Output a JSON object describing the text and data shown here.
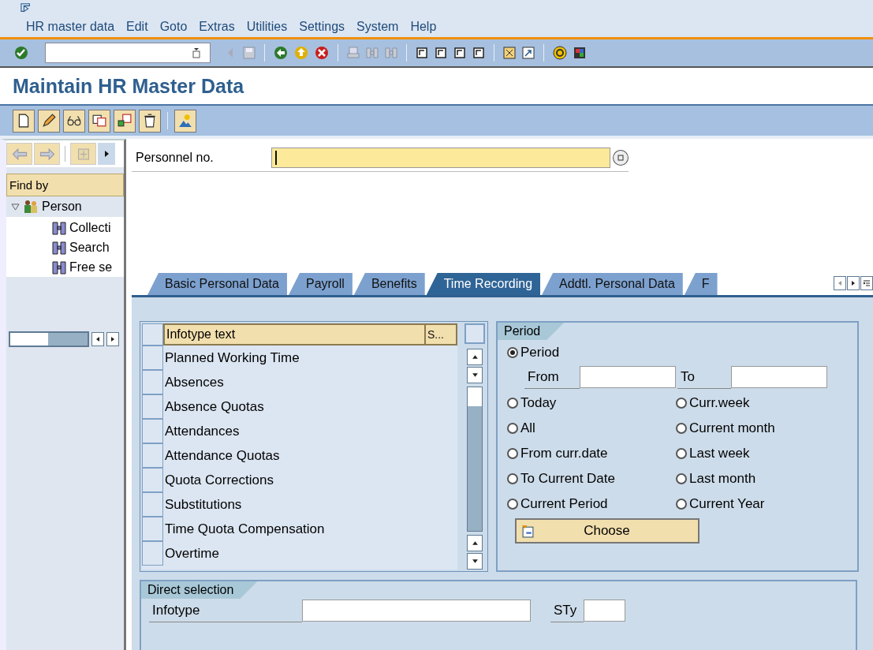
{
  "menu": [
    "HR master data",
    "Edit",
    "Goto",
    "Extras",
    "Utilities",
    "Settings",
    "System",
    "Help"
  ],
  "title": "Maintain HR Master Data",
  "sidebar": {
    "header": "Find by",
    "tree": [
      {
        "label": "Person",
        "expanded": true,
        "children": [
          {
            "label": "Collecti"
          },
          {
            "label": "Search"
          },
          {
            "label": "Free se"
          }
        ]
      }
    ]
  },
  "personnel": {
    "label": "Personnel no."
  },
  "tabs": [
    {
      "label": "Basic Personal Data",
      "selected": false
    },
    {
      "label": "Payroll",
      "selected": false
    },
    {
      "label": "Benefits",
      "selected": false
    },
    {
      "label": "Time Recording",
      "selected": true
    },
    {
      "label": "Addtl. Personal Data",
      "selected": false
    },
    {
      "label": "F",
      "selected": false
    }
  ],
  "infotypes": {
    "columns": [
      "Infotype text",
      "S..."
    ],
    "rows": [
      "Planned Working Time",
      "Absences",
      "Absence Quotas",
      "Attendances",
      "Attendance Quotas",
      "Quota Corrections",
      "Substitutions",
      "Time Quota Compensation",
      "Overtime"
    ]
  },
  "period": {
    "title": "Period",
    "from_label": "From",
    "to_label": "To",
    "button": "Choose",
    "options": [
      {
        "label": "Period",
        "selected": true
      },
      {
        "label": "Today",
        "selected": false
      },
      {
        "label": "Curr.week",
        "selected": false
      },
      {
        "label": "All",
        "selected": false
      },
      {
        "label": "Current month",
        "selected": false
      },
      {
        "label": "From curr.date",
        "selected": false
      },
      {
        "label": "Last week",
        "selected": false
      },
      {
        "label": "To Current Date",
        "selected": false
      },
      {
        "label": "Last month",
        "selected": false
      },
      {
        "label": "Current Period",
        "selected": false
      },
      {
        "label": "Current Year",
        "selected": false
      }
    ]
  },
  "direct": {
    "title": "Direct selection",
    "infotype_label": "Infotype",
    "sty_label": "STy"
  }
}
